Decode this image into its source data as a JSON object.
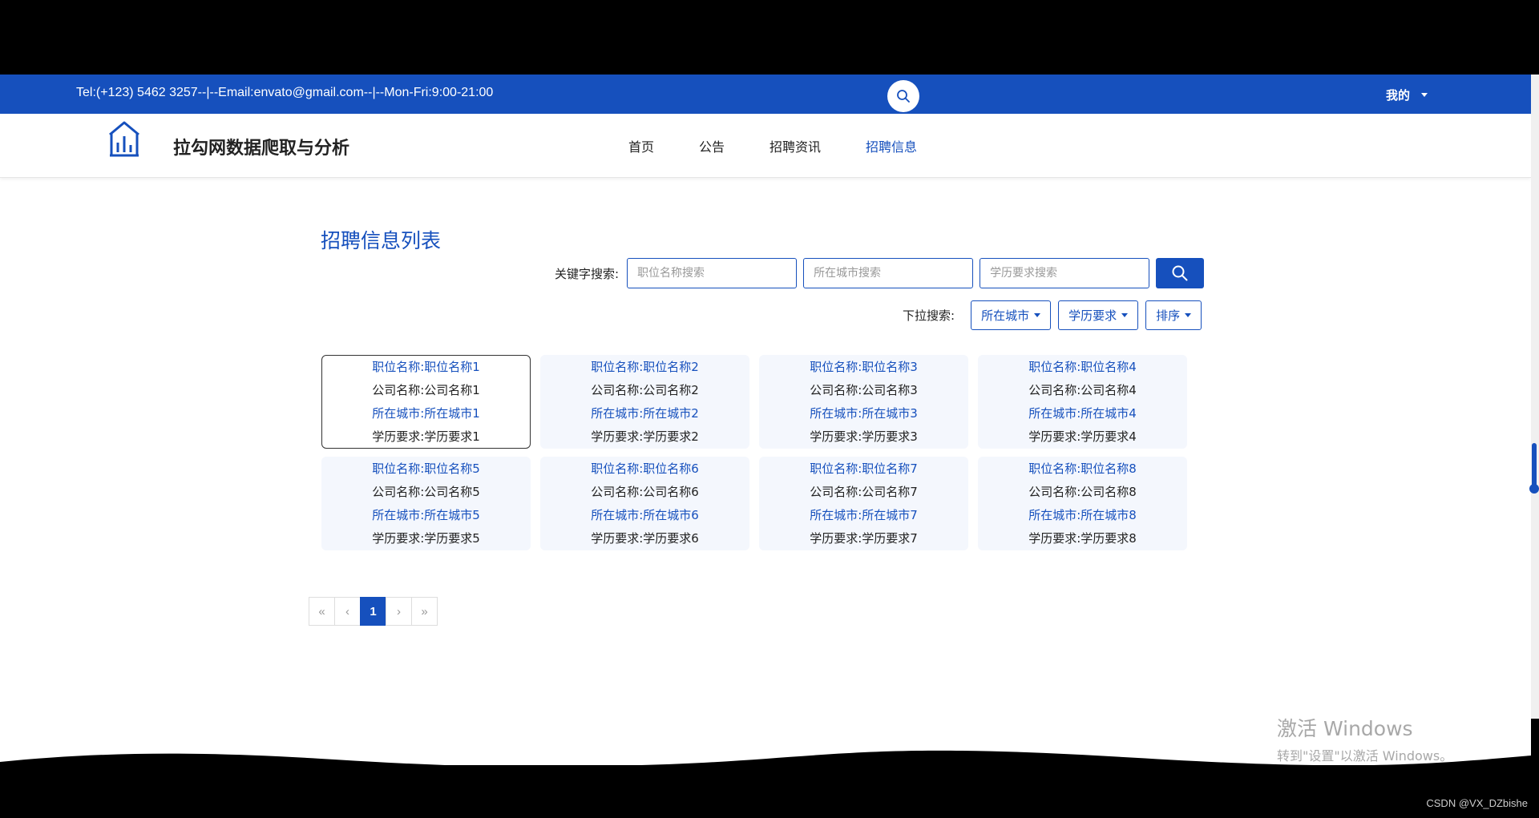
{
  "topbar": {
    "contact": "Tel:(+123) 5462 3257--|--Email:envato@gmail.com--|--Mon-Fri:9:00-21:00",
    "search_icon": "search-icon",
    "user_menu": "我的"
  },
  "navbar": {
    "site_title": "拉勾网数据爬取与分析",
    "items": [
      {
        "label": "首页"
      },
      {
        "label": "公告"
      },
      {
        "label": "招聘资讯"
      },
      {
        "label": "招聘信息"
      }
    ],
    "active_index": 3
  },
  "main": {
    "title": "招聘信息列表",
    "keyword_label": "关键字搜索:",
    "inputs": [
      {
        "placeholder": "职位名称搜索",
        "value": ""
      },
      {
        "placeholder": "所在城市搜索",
        "value": ""
      },
      {
        "placeholder": "学历要求搜索",
        "value": ""
      }
    ],
    "dropdown_label": "下拉搜索:",
    "dropdowns": [
      {
        "label": "所在城市"
      },
      {
        "label": "学历要求"
      },
      {
        "label": "排序"
      }
    ],
    "cards": [
      {
        "job": "职位名称:职位名称1",
        "company": "公司名称:公司名称1",
        "city": "所在城市:所在城市1",
        "education": "学历要求:学历要求1"
      },
      {
        "job": "职位名称:职位名称2",
        "company": "公司名称:公司名称2",
        "city": "所在城市:所在城市2",
        "education": "学历要求:学历要求2"
      },
      {
        "job": "职位名称:职位名称3",
        "company": "公司名称:公司名称3",
        "city": "所在城市:所在城市3",
        "education": "学历要求:学历要求3"
      },
      {
        "job": "职位名称:职位名称4",
        "company": "公司名称:公司名称4",
        "city": "所在城市:所在城市4",
        "education": "学历要求:学历要求4"
      },
      {
        "job": "职位名称:职位名称5",
        "company": "公司名称:公司名称5",
        "city": "所在城市:所在城市5",
        "education": "学历要求:学历要求5"
      },
      {
        "job": "职位名称:职位名称6",
        "company": "公司名称:公司名称6",
        "city": "所在城市:所在城市6",
        "education": "学历要求:学历要求6"
      },
      {
        "job": "职位名称:职位名称7",
        "company": "公司名称:公司名称7",
        "city": "所在城市:所在城市7",
        "education": "学历要求:学历要求7"
      },
      {
        "job": "职位名称:职位名称8",
        "company": "公司名称:公司名称8",
        "city": "所在城市:所在城市8",
        "education": "学历要求:学历要求8"
      }
    ],
    "pagination": {
      "first": "«",
      "prev": "‹",
      "current": "1",
      "next": "›",
      "last": "»"
    }
  },
  "watermark": {
    "line1": "激活 Windows",
    "line2": "转到\"设置\"以激活 Windows。"
  },
  "credit": "CSDN @VX_DZbishe",
  "colors": {
    "primary": "#1650bd",
    "card_bg": "#f4f7fd"
  }
}
